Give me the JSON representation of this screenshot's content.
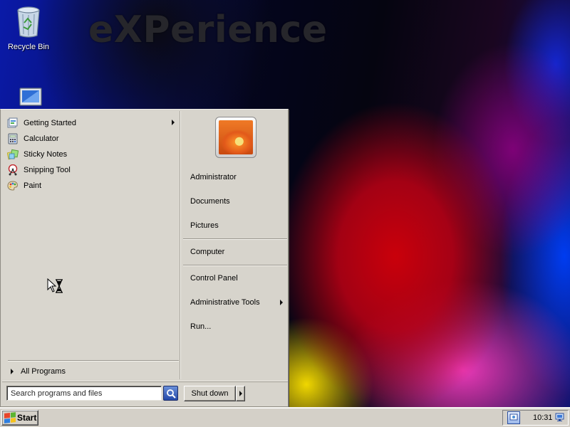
{
  "desktop": {
    "wallpaper_logo": "eXPerience",
    "icons": [
      {
        "label": "Recycle Bin",
        "icon": "recycle-bin-icon"
      },
      {
        "label": "",
        "icon": "computer-icon"
      }
    ]
  },
  "start_menu": {
    "programs": [
      {
        "label": "Getting Started",
        "icon": "getting-started-icon",
        "has_submenu": true
      },
      {
        "label": "Calculator",
        "icon": "calculator-icon",
        "has_submenu": false
      },
      {
        "label": "Sticky Notes",
        "icon": "sticky-notes-icon",
        "has_submenu": false
      },
      {
        "label": "Snipping Tool",
        "icon": "snipping-tool-icon",
        "has_submenu": false
      },
      {
        "label": "Paint",
        "icon": "paint-icon",
        "has_submenu": false
      }
    ],
    "all_programs_label": "All Programs",
    "search_placeholder": "Search programs and files",
    "right_items": [
      {
        "label": "Administrator",
        "has_submenu": false
      },
      {
        "label": "Documents",
        "has_submenu": false
      },
      {
        "label": "Pictures",
        "has_submenu": false
      },
      {
        "label": "Computer",
        "has_submenu": false
      },
      {
        "label": "Control Panel",
        "has_submenu": false
      },
      {
        "label": "Administrative Tools",
        "has_submenu": true
      },
      {
        "label": "Run...",
        "has_submenu": false
      }
    ],
    "shutdown_label": "Shut down"
  },
  "taskbar": {
    "start_label": "Start",
    "clock": "10:31"
  },
  "colors": {
    "menu_face": "#d7d4cc",
    "taskbar_face": "#d4d0c8",
    "search_button": "#2348a8"
  }
}
